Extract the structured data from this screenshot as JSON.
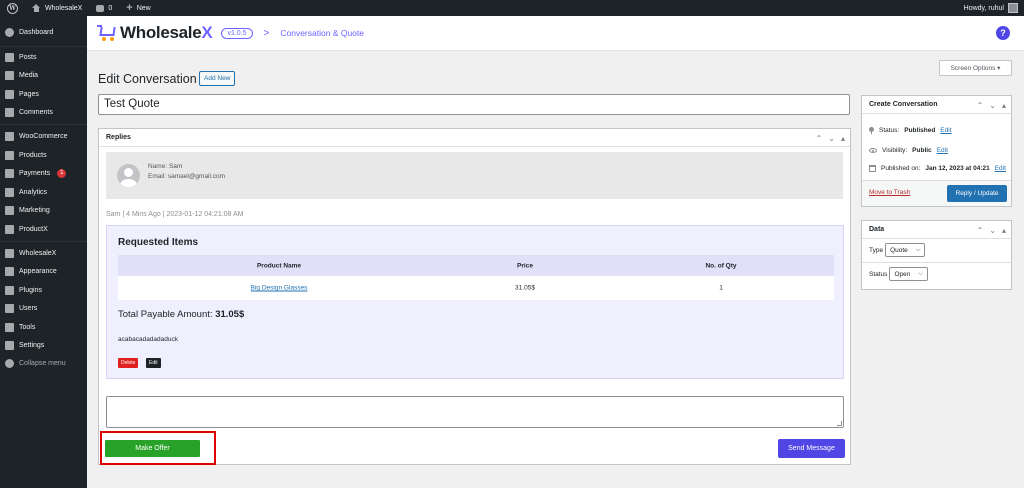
{
  "admin_bar": {
    "site_name": "WholesaleX",
    "comments_count": "0",
    "new_label": "New",
    "howdy": "Howdy, ruhul"
  },
  "sidebar": {
    "items": [
      {
        "label": "Dashboard",
        "icon": "dashboard-icon"
      },
      {
        "label": "Posts",
        "icon": "pin-icon"
      },
      {
        "label": "Media",
        "icon": "media-icon"
      },
      {
        "label": "Pages",
        "icon": "pages-icon"
      },
      {
        "label": "Comments",
        "icon": "comments-icon"
      },
      {
        "label": "WooCommerce",
        "icon": "woocommerce-icon"
      },
      {
        "label": "Products",
        "icon": "products-icon"
      },
      {
        "label": "Payments",
        "icon": "payments-icon",
        "badge": "1"
      },
      {
        "label": "Analytics",
        "icon": "analytics-icon"
      },
      {
        "label": "Marketing",
        "icon": "marketing-icon"
      },
      {
        "label": "ProductX",
        "icon": "productx-icon"
      },
      {
        "label": "WholesaleX",
        "icon": "wholesalex-icon"
      },
      {
        "label": "Appearance",
        "icon": "appearance-icon"
      },
      {
        "label": "Plugins",
        "icon": "plugins-icon"
      },
      {
        "label": "Users",
        "icon": "users-icon"
      },
      {
        "label": "Tools",
        "icon": "tools-icon"
      },
      {
        "label": "Settings",
        "icon": "settings-icon"
      },
      {
        "label": "Collapse menu",
        "icon": "collapse-icon"
      }
    ]
  },
  "header": {
    "logo_main": "Wholesale",
    "logo_accent": "X",
    "version": "v1.0.5",
    "breadcrumb_sep": ">",
    "breadcrumb": "Conversation & Quote",
    "help": "?"
  },
  "screen_options": "Screen Options ▾",
  "page": {
    "title": "Edit Conversation",
    "add_new": "Add New",
    "post_title": "Test Quote"
  },
  "replies": {
    "title": "Replies",
    "name": "Name: Sam",
    "email": "Email: samael@gmail.com",
    "meta": "Sam | 4 Mins Ago | 2023-01-12 04:21:08 AM",
    "requested_title": "Requested Items",
    "columns": [
      "Product Name",
      "Price",
      "No. of Qty"
    ],
    "rows": [
      {
        "product": "Big Design Glasses",
        "price": "31.05$",
        "qty": "1"
      }
    ],
    "total_label": "Total Payable Amount:",
    "total_value": "31.05$",
    "note": "acabacadadadaduck",
    "delete_label": "Delete",
    "edit_label": "Edit",
    "make_offer": "Make Offer",
    "send_message": "Send Message"
  },
  "create_conversation": {
    "title": "Create Conversation",
    "status_label": "Status:",
    "status_value": "Published",
    "visibility_label": "Visibility:",
    "visibility_value": "Public",
    "published_label": "Published on:",
    "published_value": "Jan 12, 2023 at 04:21",
    "edit_link": "Edit",
    "move_to_trash": "Move to Trash",
    "reply_update": "Reply / Update"
  },
  "data_box": {
    "title": "Data",
    "type_label": "Type",
    "type_value": "Quote",
    "status_label": "Status",
    "status_value": "Open"
  },
  "colors": {
    "accent": "#6c63ff",
    "primary": "#2271b1",
    "make_offer": "#28a228",
    "send_message": "#5046e5",
    "delete": "#e02020",
    "highlight_frame": "#e00000"
  }
}
